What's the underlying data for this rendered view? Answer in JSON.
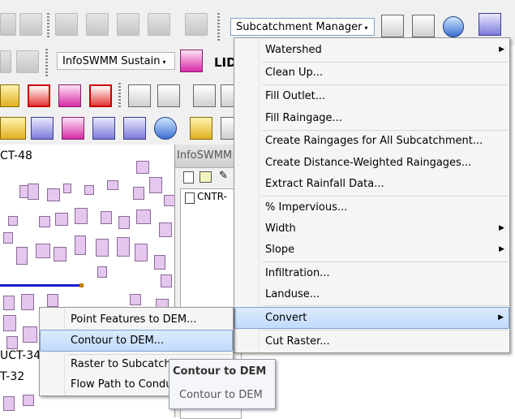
{
  "toolbars": {
    "subcatchment_dropdown": "Subcatchment Manager",
    "sustain_dropdown": "InfoSWMM Sustain",
    "lid_label": "LID"
  },
  "side_panel": {
    "title": "InfoSWMM",
    "item": "CNTR-"
  },
  "map": {
    "labels": [
      "CT-48",
      "UCT-34",
      "T-32"
    ]
  },
  "main_menu": {
    "items": [
      {
        "label": "Watershed",
        "submenu": true
      },
      {
        "label": "Clean Up..."
      },
      {
        "label": "Fill Outlet..."
      },
      {
        "label": "Fill Raingage..."
      },
      {
        "label": "Create Raingages for All Subcatchment..."
      },
      {
        "label": "Create Distance-Weighted Raingages..."
      },
      {
        "label": "Extract Rainfall Data..."
      },
      {
        "label": "% Impervious..."
      },
      {
        "label": "Width",
        "submenu": true
      },
      {
        "label": "Slope",
        "submenu": true
      },
      {
        "label": "Infiltration..."
      },
      {
        "label": "Landuse..."
      },
      {
        "label": "Convert",
        "submenu": true,
        "highlighted": true
      },
      {
        "label": "Cut Raster..."
      }
    ]
  },
  "convert_menu": {
    "items": [
      {
        "label": "Point Features to DEM..."
      },
      {
        "label": "Contour to DEM...",
        "highlighted": true
      },
      {
        "label": "Raster to Subcatchment"
      },
      {
        "label": "Flow Path to Conduit"
      }
    ]
  },
  "tooltip": {
    "title": "Contour to DEM",
    "body": "Contour to DEM"
  }
}
